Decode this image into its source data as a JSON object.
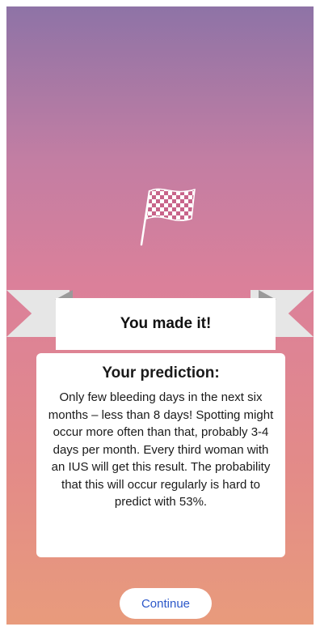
{
  "banner": {
    "title": "You made it!"
  },
  "prediction": {
    "title": "Your prediction:",
    "body": "Only few bleeding days in the next six months – less than 8 days! Spotting might occur more often than that, probably 3-4 days per month. Every third woman with an IUS will get this result. The probability that this will occur regularly is hard to predict with 53%."
  },
  "actions": {
    "continue_label": "Continue"
  },
  "icons": {
    "flag": "checkered-flag-icon"
  },
  "colors": {
    "link": "#2c58c9",
    "ribbon": "#e6e6e6"
  }
}
